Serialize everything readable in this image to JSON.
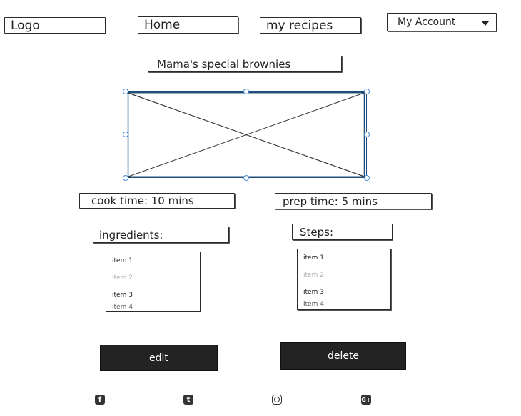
{
  "nav": {
    "logo": "Logo",
    "home": "Home",
    "my_recipes": "my recipes",
    "my_account": "My Account"
  },
  "recipe": {
    "title": "Mama's special brownies",
    "cook_time": "cook time: 10 mins",
    "prep_time": "prep time:  5 mins"
  },
  "ingredients": {
    "label": "ingredients:",
    "items": [
      "item 1",
      "item 2",
      "item 3",
      "item 4"
    ]
  },
  "steps": {
    "label": "Steps:",
    "items": [
      "item 1",
      "item 2",
      "item 3",
      "item 4"
    ]
  },
  "actions": {
    "edit": "edit",
    "delete": "delete"
  },
  "footer": {
    "icons": [
      "facebook-icon",
      "twitter-icon",
      "instagram-icon",
      "google-plus-icon"
    ]
  }
}
